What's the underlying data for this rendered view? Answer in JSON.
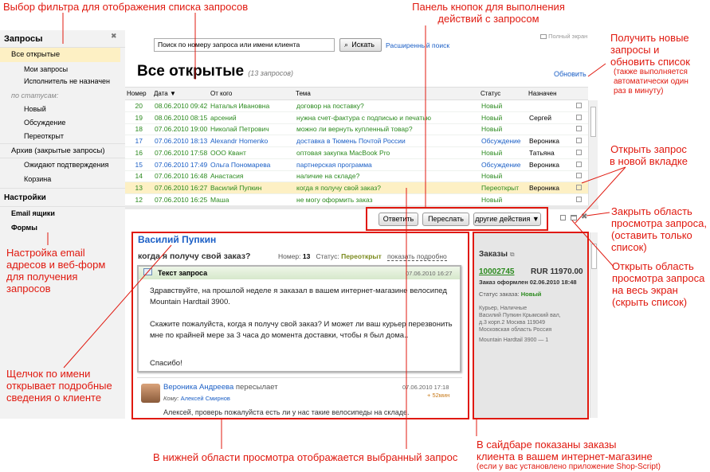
{
  "annotations": {
    "filter": "Выбор фильтра для отображения списка запросов",
    "toolbar": "Панель кнопок для выполнения\nдействий с запросом",
    "refresh_main": "Получить новые\nзапросы и\nобновить список",
    "refresh_note": "(также выполняется\nавтоматически один\nраз в минуту)",
    "new_tab": "Открыть запрос\nв новой вкладке",
    "close_view": "Закрыть область\nпросмотра запроса,\n(оставить только\nсписок)",
    "fullscreen_view": "Открыть область\nпросмотра запроса\nна весь экран\n(скрыть список)",
    "email_settings": "Настройка email\nадресов и веб-форм\nдля получения\nзапросов",
    "client_click": "Щелчок по имени\nоткрывает подробные\nсведения о клиенте",
    "bottom_view": "В нижней области просмотра отображается выбранный запрос",
    "sidebar_orders": "В сайдбаре показаны заказы\nклиента в вашем интернет-магазине",
    "sidebar_orders_note": "(если у вас установлено приложение Shop-Script)"
  },
  "sidebar": {
    "title": "Запросы",
    "close_glyph": "✖",
    "items": [
      {
        "label": "Все открытые",
        "active": true
      },
      {
        "label": "Мои запросы"
      },
      {
        "label": "Исполнитель не назначен"
      }
    ],
    "by_status_label": "по статусам:",
    "status_items": [
      "Новый",
      "Обсуждение",
      "Переоткрыт"
    ],
    "archive_label": "Архив (закрытые запросы)",
    "archive_items": [
      "Ожидают подтверждения",
      "Корзина"
    ],
    "settings_title": "Настройки",
    "settings_items": [
      "Email ящики",
      "Формы"
    ]
  },
  "search": {
    "placeholder": "Поиск по номеру запроса или имени клиента",
    "button": "Искать",
    "advanced": "Расширенный поиск",
    "fullscreen": "Полный экран"
  },
  "list": {
    "title": "Все открытые",
    "count": "(13 запросов)",
    "refresh": "Обновить",
    "headers": [
      "Номер",
      "Дата ▼",
      "От кого",
      "Тема",
      "Статус",
      "Назначен"
    ],
    "rows": [
      {
        "num": "20",
        "date": "08.06.2010 09:42",
        "from": "Наталья Ивановна",
        "topic": "договор на поставку?",
        "status": "Новый",
        "assign": "",
        "color": "g"
      },
      {
        "num": "19",
        "date": "08.06.2010 08:15",
        "from": "арсений",
        "topic": "нужна счет-фактура с подписью и печатью",
        "status": "Новый",
        "assign": "Сергей",
        "color": "g"
      },
      {
        "num": "18",
        "date": "07.06.2010 19:00",
        "from": "Николай Петрович",
        "topic": "можно ли вернуть купленный товар?",
        "status": "Новый",
        "assign": "",
        "color": "g"
      },
      {
        "num": "17",
        "date": "07.06.2010 18:13",
        "from": "Alexandr Homenko",
        "topic": "доставка в Тюмень Почтой России",
        "status": "Обсуждение",
        "assign": "Вероника",
        "color": "bl"
      },
      {
        "num": "16",
        "date": "07.06.2010 17:58",
        "from": "ООО Квант",
        "topic": "оптовая закупка MacBook Pro",
        "status": "Новый",
        "assign": "Татьяна",
        "color": "g"
      },
      {
        "num": "15",
        "date": "07.06.2010 17:49",
        "from": "Ольга Пономарева",
        "topic": "партнерская программа",
        "status": "Обсуждение",
        "assign": "Вероника",
        "color": "bl"
      },
      {
        "num": "14",
        "date": "07.06.2010 16:48",
        "from": "Анастасия",
        "topic": "наличие на складе?",
        "status": "Новый",
        "assign": "",
        "color": "g"
      },
      {
        "num": "13",
        "date": "07.06.2010 16:27",
        "from": "Василий Пупкин",
        "topic": "когда я получу свой заказ?",
        "status": "Переоткрыт",
        "assign": "Вероника",
        "color": "g",
        "selected": true
      },
      {
        "num": "12",
        "date": "07.06.2010 16:25",
        "from": "Маша",
        "topic": "не могу оформить заказ",
        "status": "Новый",
        "assign": "",
        "color": "g"
      }
    ]
  },
  "toolbar": {
    "reply": "Ответить",
    "forward": "Переслать",
    "more": "другие действия ▼"
  },
  "request": {
    "client": "Василий Пупкин",
    "subject": "когда я получу свой заказ?",
    "number_label": "Номер:",
    "number": "13",
    "status_label": "Статус:",
    "status": "Переоткрыт",
    "details_link": "показать подробно",
    "message_title": "Текст запроса",
    "message_date": "07.06.2010 16:27",
    "body1": "Здравствуйте, на прошлой неделе я заказал в вашем интернет-магазине велосипед Mountain Hardtail 3900.",
    "body2": "Скажите пожалуйста, когда я получу свой заказ? И может ли ваш курьер перезвонить мне по крайней мере за 3 часа до момента доставки, чтобы я был дома..",
    "body3": "Спасибо!",
    "reply_author": "Вероника Андреева",
    "reply_action": "пересылает",
    "reply_to_label": "Кому:",
    "reply_to": "Алексей Смирнов",
    "reply_date": "07.06.2010 17:18",
    "reply_delay": "+ 52мин",
    "reply_text": "Алексей, проверь пожалуйста есть ли у нас такие велосипеды на складе."
  },
  "orders": {
    "title": "Заказы",
    "id": "10002745",
    "amount": "RUR 11970.00",
    "placed": "Заказ оформлен 02.06.2010 18:48",
    "status_label": "Статус заказа:",
    "status": "Новый",
    "delivery": "Курьер, Наличные",
    "address1": "Василий Пупкин Крымский вал,",
    "address2": "д.3 корп.2 Москва 119049",
    "address3": "Московская область Россия",
    "item": "Mountain Hardtail 3900 — 1"
  }
}
